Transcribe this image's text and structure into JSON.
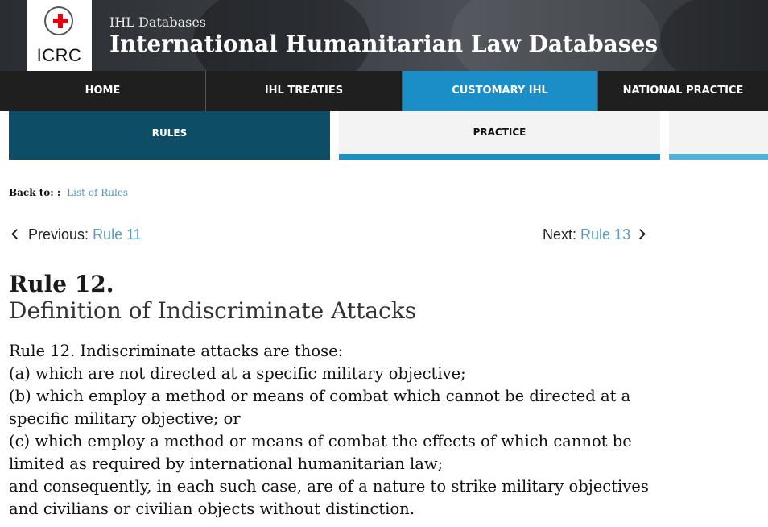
{
  "header": {
    "logo_text": "ICRC",
    "kicker": "IHL Databases",
    "title": "International Humanitarian Law Databases"
  },
  "mainnav": [
    {
      "label": "HOME",
      "active": false
    },
    {
      "label": "IHL TREATIES",
      "active": false
    },
    {
      "label": "CUSTOMARY IHL",
      "active": true
    },
    {
      "label": "NATIONAL PRACTICE",
      "active": false
    }
  ],
  "subnav": {
    "rules": "RULES",
    "practice": "PRACTICE"
  },
  "back": {
    "label": "Back to: :",
    "link": "List of Rules"
  },
  "pager": {
    "prev_label": "Previous:",
    "prev_link": "Rule 11",
    "next_label": "Next:",
    "next_link": "Rule 13"
  },
  "rule": {
    "number": "Rule 12.",
    "title": "Definition of Indiscriminate Attacks",
    "lines": [
      "Rule 12. Indiscriminate attacks are those:",
      "(a) which are not directed at a specific military objective;",
      "(b) which employ a method or means of combat which cannot be directed at a",
      "specific military objective; or",
      "(c) which employ a method or means of combat the effects of which cannot be",
      "limited as required by international humanitarian law;",
      "and consequently, in each such case, are of a nature to strike military objectives",
      "and civilians or civilian objects without distinction."
    ]
  },
  "colors": {
    "active_nav": "#1b8ec7",
    "rules_tab": "#0d4d66",
    "link": "#5a9cbc",
    "emblem_cross": "#e3000f"
  }
}
